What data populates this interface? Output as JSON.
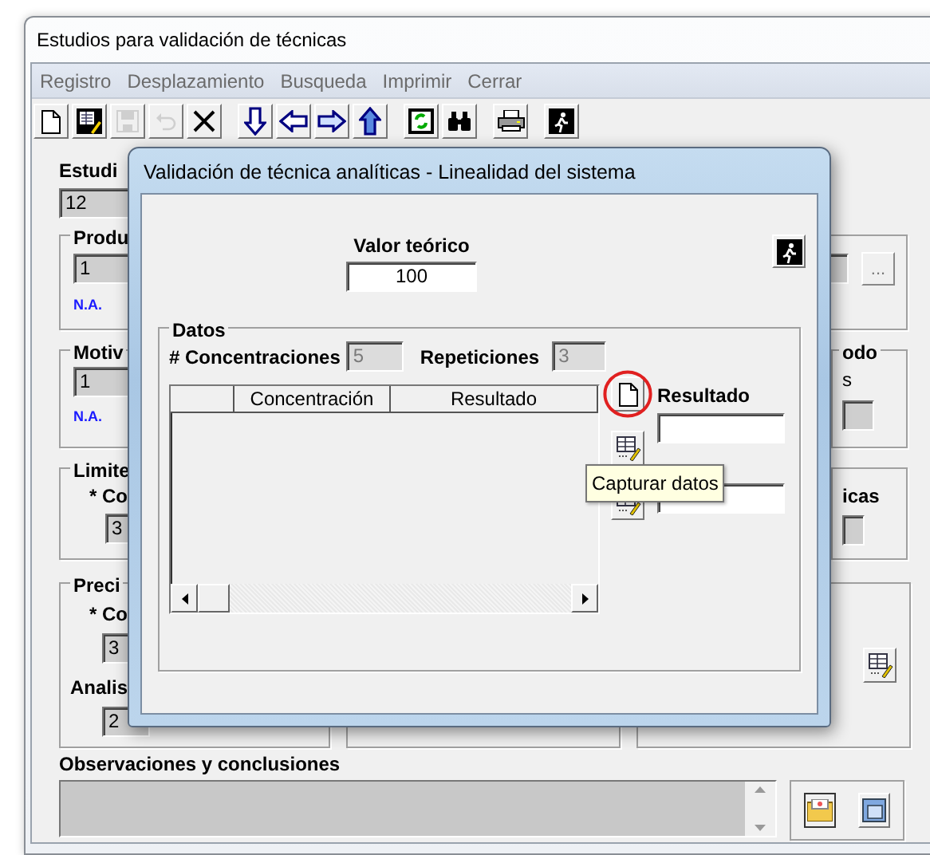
{
  "window": {
    "title": "Estudios para validación de técnicas"
  },
  "menu": [
    {
      "label": "Registro"
    },
    {
      "label": "Desplazamiento"
    },
    {
      "label": "Busqueda"
    },
    {
      "label": "Imprimir"
    },
    {
      "label": "Cerrar"
    }
  ],
  "toolbar": [
    {
      "buttons": [
        {
          "kind": "new",
          "disabled": false
        },
        {
          "kind": "edit",
          "disabled": false
        },
        {
          "kind": "save",
          "disabled": true
        },
        {
          "kind": "undo",
          "disabled": true
        },
        {
          "kind": "delete",
          "disabled": false
        }
      ]
    },
    {
      "buttons": [
        {
          "kind": "down",
          "disabled": false
        },
        {
          "kind": "left",
          "disabled": false
        },
        {
          "kind": "right",
          "disabled": false
        },
        {
          "kind": "up",
          "disabled": false
        }
      ]
    },
    {
      "buttons": [
        {
          "kind": "refresh",
          "disabled": false
        },
        {
          "kind": "search",
          "disabled": false
        }
      ]
    },
    {
      "buttons": [
        {
          "kind": "print",
          "disabled": false
        }
      ]
    },
    {
      "buttons": [
        {
          "kind": "exit",
          "disabled": false
        }
      ]
    }
  ],
  "form": {
    "study": {
      "label": "Estudi",
      "value": "12"
    },
    "product": {
      "label": "Produ",
      "value": "1",
      "note": "N.A.",
      "browse": "..."
    },
    "motive": {
      "label": "Motiv",
      "value": "1",
      "note": "N.A."
    },
    "method": {
      "label": "odo",
      "text": "s"
    },
    "limits": {
      "label": "Limite",
      "sublabel": "* Co",
      "value": "3"
    },
    "techniques": {
      "label": "icas"
    },
    "precision": {
      "label": "Preci",
      "sublabel": "* Co",
      "value": "3",
      "analysis_label": "Analis",
      "analysis_value": "2"
    },
    "observations": {
      "label": "Observaciones y conclusiones"
    }
  },
  "dialog": {
    "title": "Validación de técnica analíticas - Linealidad del sistema",
    "theoretical_value": {
      "label": "Valor teórico",
      "value": "100"
    },
    "data": {
      "label": "Datos",
      "concentrations": {
        "label": "# Concentraciones",
        "value": "5",
        "disabled": true
      },
      "repetitions": {
        "label": "Repeticiones",
        "value": "3",
        "disabled": true
      },
      "table": {
        "columns": [
          "Concentración",
          "Resultado"
        ]
      },
      "tools": [
        {
          "kind": "new",
          "highlighted": true
        },
        {
          "kind": "edit",
          "highlighted": false
        },
        {
          "kind": "grid",
          "highlighted": false
        }
      ],
      "result": {
        "label": "Resultado"
      }
    }
  },
  "tooltip": {
    "text": "Capturar datos"
  }
}
